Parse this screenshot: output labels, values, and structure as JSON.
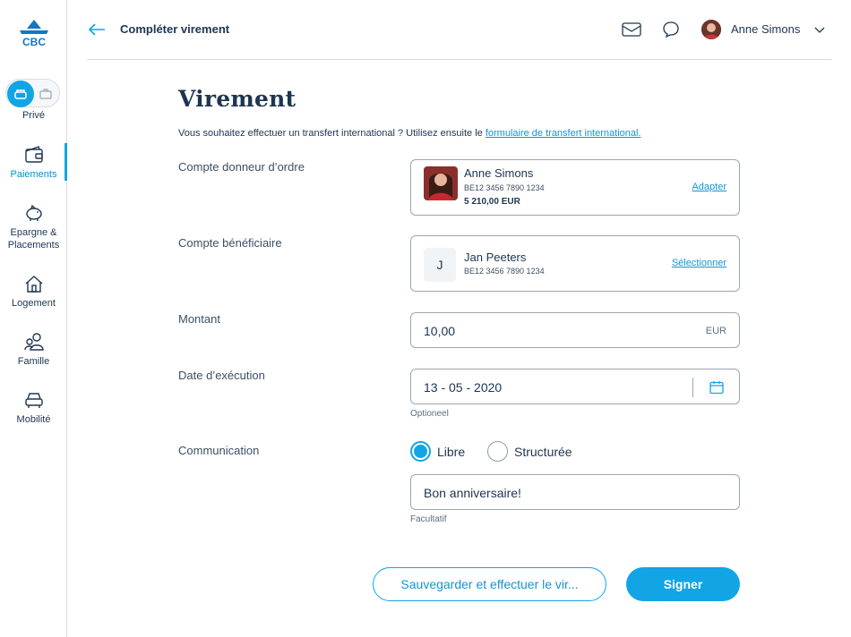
{
  "sidebar": {
    "logo_text": "CBC",
    "profile_toggle": {
      "label": "Privé"
    },
    "items": [
      {
        "label": "Paiements",
        "icon": "wallet-icon",
        "active": true
      },
      {
        "label": "Epargne & Placements",
        "icon": "piggy-bank-icon"
      },
      {
        "label": "Logement",
        "icon": "house-icon"
      },
      {
        "label": "Famille",
        "icon": "family-icon"
      },
      {
        "label": "Mobilité",
        "icon": "car-icon"
      }
    ]
  },
  "header": {
    "title": "Compléter virement",
    "user_name": "Anne Simons",
    "icons": [
      "back-arrow-icon",
      "mail-icon",
      "chat-icon",
      "chevron-down-icon"
    ]
  },
  "page": {
    "title": "Virement",
    "intro_text": "Vous souhaitez effectuer un transfert international ? Utilisez ensuite le ",
    "intro_link": "formulaire de transfert international."
  },
  "form": {
    "donor": {
      "label": "Compte donneur d’ordre",
      "name": "Anne Simons",
      "iban": "BE12 3456 7890 1234",
      "balance": "5 210,00 EUR",
      "action": "Adapter"
    },
    "beneficiary": {
      "label": "Compte bénéficiaire",
      "initial": "J",
      "name": "Jan Peeters",
      "iban": "BE12 3456 7890 1234",
      "action": "Sélectionner"
    },
    "amount": {
      "label": "Montant",
      "value": "10,00",
      "currency": "EUR"
    },
    "date": {
      "label": "Date d’exécution",
      "value": "13 - 05 - 2020",
      "hint": "Optioneel"
    },
    "communication": {
      "label": "Communication",
      "options": [
        {
          "label": "Libre",
          "selected": true
        },
        {
          "label": "Structurée",
          "selected": false
        }
      ],
      "value": "Bon anniversaire!",
      "hint": "Facultatif"
    }
  },
  "buttons": {
    "save": "Sauvegarder et effectuer le vir...",
    "sign": "Signer"
  },
  "colors": {
    "accent": "#11a5e6",
    "text": "#1d3550",
    "border": "#9aa7b3",
    "logo": "#1576c2"
  }
}
